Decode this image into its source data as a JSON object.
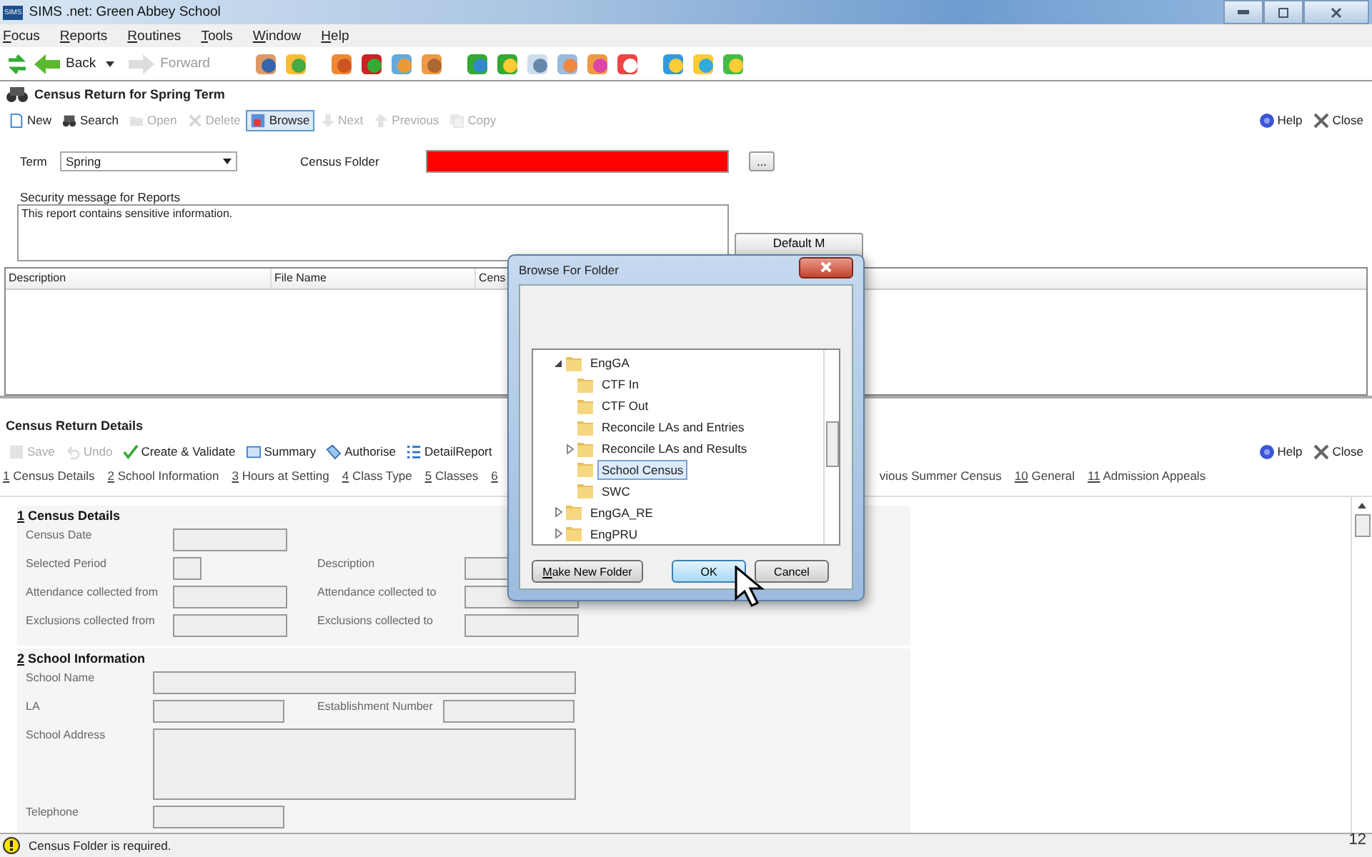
{
  "window": {
    "badge": "SIMS",
    "title": "SIMS .net: Green Abbey School"
  },
  "menu": [
    {
      "key": "F",
      "rest": "ocus"
    },
    {
      "key": "R",
      "rest": "eports"
    },
    {
      "key": "R",
      "rest": "outines"
    },
    {
      "key": "T",
      "rest": "ools"
    },
    {
      "key": "W",
      "rest": "indow"
    },
    {
      "key": "H",
      "rest": "elp"
    }
  ],
  "nav": [
    {
      "kind": "back",
      "label": "Back",
      "disabled": false
    },
    {
      "kind": "forward",
      "label": "Forward",
      "disabled": true
    }
  ],
  "top_panel": {
    "title": "Census Return for Spring Term",
    "toolbar": [
      {
        "kind": "new",
        "label": "New",
        "disabled": false,
        "selected": false
      },
      {
        "kind": "search",
        "label": "Search",
        "disabled": false,
        "selected": false
      },
      {
        "kind": "open",
        "label": "Open",
        "disabled": true,
        "selected": false
      },
      {
        "kind": "delete",
        "label": "Delete",
        "disabled": true,
        "selected": false
      },
      {
        "kind": "browse",
        "label": "Browse",
        "disabled": false,
        "selected": true
      },
      {
        "kind": "next",
        "label": "Next",
        "disabled": true,
        "selected": false
      },
      {
        "kind": "previous",
        "label": "Previous",
        "disabled": true,
        "selected": false
      },
      {
        "kind": "copy",
        "label": "Copy",
        "disabled": true,
        "selected": false
      }
    ],
    "help": "Help",
    "close": "Close",
    "term_label": "Term",
    "term_value": "Spring",
    "folder_label": "Census Folder",
    "folder_invalid": true,
    "folder_button": "...",
    "security_label": "Security message for Reports",
    "security_value": "This report contains sensitive information.",
    "default_button": "Default M",
    "columns": [
      "Description",
      "File Name",
      "Cens"
    ]
  },
  "details": {
    "title": "Census Return Details",
    "toolbar": [
      {
        "kind": "save",
        "label": "Save",
        "disabled": true,
        "selected": false
      },
      {
        "kind": "undo",
        "label": "Undo",
        "disabled": true,
        "selected": false
      },
      {
        "kind": "validate",
        "label": "Create & Validate",
        "disabled": false,
        "selected": false
      },
      {
        "kind": "summary",
        "label": "Summary",
        "disabled": false,
        "selected": false
      },
      {
        "kind": "authorise",
        "label": "Authorise",
        "disabled": false,
        "selected": false
      },
      {
        "kind": "report",
        "label": "DetailReport",
        "disabled": false,
        "selected": false
      }
    ],
    "help": "Help",
    "close": "Close",
    "tabs_left": [
      {
        "num": "1",
        "label": "Census Details"
      },
      {
        "num": "2",
        "label": "School Information"
      },
      {
        "num": "3",
        "label": "Hours at Setting"
      },
      {
        "num": "4",
        "label": "Class Type"
      },
      {
        "num": "5",
        "label": "Classes"
      },
      {
        "num": "6"
      }
    ],
    "tabs_right": [
      {
        "label": "vious Summer Census"
      },
      {
        "num": "10",
        "label": "General"
      },
      {
        "num": "11",
        "label": "Admission Appeals"
      }
    ],
    "sections": [
      {
        "num": "1",
        "title": "Census Details",
        "rows": [
          [
            {
              "label": "Census Date",
              "kind": "text"
            }
          ],
          [
            {
              "label": "Selected Period",
              "kind": "text"
            },
            {
              "label": "Description",
              "kind": "text"
            }
          ],
          [
            {
              "label": "Attendance collected from",
              "kind": "text"
            },
            {
              "label": "Attendance collected to",
              "kind": "text"
            }
          ],
          [
            {
              "label": "Exclusions collected from",
              "kind": "text"
            },
            {
              "label": "Exclusions collected to",
              "kind": "text"
            }
          ]
        ]
      },
      {
        "num": "2",
        "title": "School Information",
        "rows": [
          [
            {
              "label": "School Name",
              "kind": "text"
            }
          ],
          [
            {
              "label": "LA",
              "kind": "text"
            },
            {
              "label": "Establishment Number",
              "kind": "text"
            }
          ],
          [
            {
              "label": "School Address",
              "kind": "textarea"
            }
          ],
          [
            {
              "label": "Telephone",
              "kind": "text"
            }
          ]
        ]
      }
    ]
  },
  "status": {
    "message": "Census Folder is required.",
    "page_number": "12"
  },
  "dialog": {
    "title": "Browse For Folder",
    "tree": [
      {
        "label": "EngGA",
        "expanded": true,
        "selected": false,
        "children": [
          {
            "label": "CTF In",
            "selected": false
          },
          {
            "label": "CTF Out",
            "selected": false
          },
          {
            "label": "Reconcile LAs and Entries",
            "selected": false
          },
          {
            "label": "Reconcile LAs and Results",
            "expanded": false,
            "selected": false
          },
          {
            "label": "School Census",
            "selected": true
          },
          {
            "label": "SWC",
            "selected": false
          }
        ]
      },
      {
        "label": "EngGA_RE",
        "expanded": false,
        "selected": false
      },
      {
        "label": "EngPRU",
        "expanded": false,
        "selected": false
      }
    ],
    "buttons": [
      {
        "label": "Make New Folder",
        "mnemonic": true,
        "default": false
      },
      {
        "label": "OK",
        "default": true
      },
      {
        "label": "Cancel",
        "default": false
      }
    ]
  }
}
